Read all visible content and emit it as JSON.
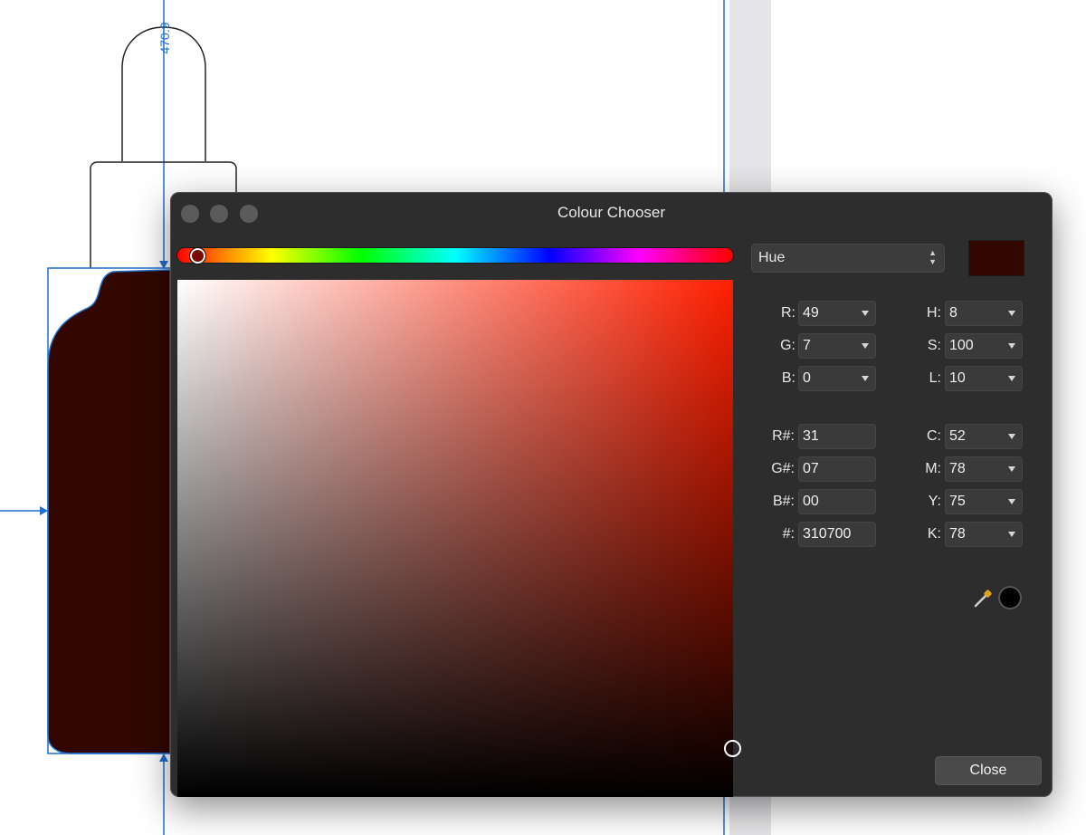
{
  "canvas": {
    "dimension_label": "470.9"
  },
  "dialog": {
    "title": "Colour Chooser",
    "mode_select": {
      "value": "Hue"
    },
    "current_color": "#310700",
    "hue_slider": {
      "hue": 8
    },
    "sv_picker": {
      "saturation": 100,
      "lightness": 10
    },
    "rgb": {
      "r": {
        "label": "R:",
        "value": "49"
      },
      "g": {
        "label": "G:",
        "value": "7"
      },
      "b": {
        "label": "B:",
        "value": "0"
      }
    },
    "hsl": {
      "h": {
        "label": "H:",
        "value": "8"
      },
      "s": {
        "label": "S:",
        "value": "100"
      },
      "l": {
        "label": "L:",
        "value": "10"
      }
    },
    "hex": {
      "r": {
        "label": "R#:",
        "value": "31"
      },
      "g": {
        "label": "G#:",
        "value": "07"
      },
      "b": {
        "label": "B#:",
        "value": "00"
      },
      "full": {
        "label": "#:",
        "value": "310700"
      }
    },
    "cmyk": {
      "c": {
        "label": "C:",
        "value": "52"
      },
      "m": {
        "label": "M:",
        "value": "78"
      },
      "y": {
        "label": "Y:",
        "value": "75"
      },
      "k": {
        "label": "K:",
        "value": "78"
      }
    },
    "eyedropper_icon": "eyedropper-icon",
    "close_label": "Close"
  }
}
